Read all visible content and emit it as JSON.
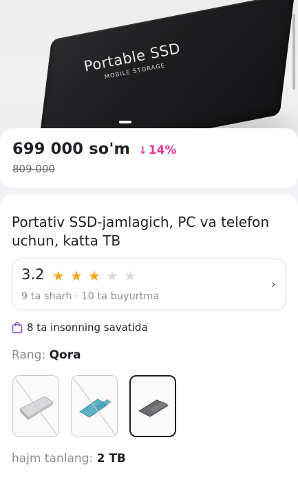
{
  "hero": {
    "brand_text": "Portable SSD",
    "sub_text": "MOBILE STORAGE",
    "image_icon": "portable-ssd-photo"
  },
  "price": {
    "current": "699 000 so'm",
    "discount": "14%",
    "discount_icon": "arrow-down-icon",
    "old": "809 000"
  },
  "product": {
    "title": "Portativ SSD-jamlagich, PC va telefon uchun, katta TB"
  },
  "rating": {
    "score": "3.2",
    "stars_filled": 3,
    "stars_total": 5,
    "meta": "9 ta sharh · 10  ta buyurtma",
    "star_color": "#f6a623"
  },
  "cart": {
    "text": "8 ta insonning savatida",
    "icon": "shopping-bag-icon"
  },
  "color": {
    "label": "Rang:",
    "value": "Qora"
  },
  "variants": [
    {
      "name": "silver",
      "selected": false,
      "available": false
    },
    {
      "name": "blue",
      "selected": false,
      "available": false
    },
    {
      "name": "black",
      "selected": true,
      "available": true
    }
  ],
  "size": {
    "label": "hajm tanlang:",
    "value": "2 TB"
  },
  "colors": {
    "accent_pink": "#e23a96",
    "text": "#1f2026",
    "muted": "#8b8c94"
  }
}
